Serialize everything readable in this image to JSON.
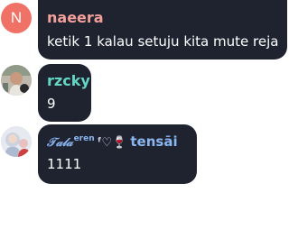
{
  "messages": [
    {
      "avatar_initial": "N",
      "avatar_color": "#f07266",
      "sender": "naeera",
      "sender_color": "#f4a09a",
      "text": "ketik 1 kalau setuju kita mute reja"
    },
    {
      "sender": "rzcky",
      "sender_color": "#66d6c4",
      "text": "9"
    },
    {
      "sender_script": "𝒯𝒶𝓁𝒶",
      "sender_sup": "eren",
      "sender_emoji": "ᶠ♡",
      "sender_wine": "🍷",
      "sender_rest": "tensāi",
      "sender_color": "#8ab6f0",
      "text": "1111"
    }
  ],
  "bubble_color": "#1f2330"
}
